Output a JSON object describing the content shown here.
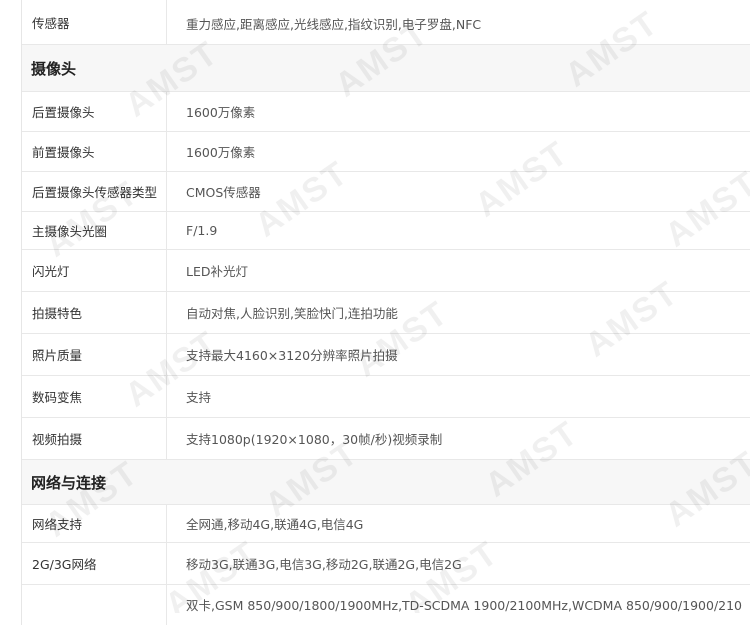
{
  "sections": [
    {
      "rows": [
        {
          "label": "传感器",
          "value": "重力感应,距离感应,光线感应,指纹识别,电子罗盘,NFC"
        }
      ]
    },
    {
      "title": "摄像头",
      "rows": [
        {
          "label": "后置摄像头",
          "value": "1600万像素"
        },
        {
          "label": "前置摄像头",
          "value": "1600万像素"
        },
        {
          "label": "后置摄像头传感器类型",
          "value": "CMOS传感器"
        },
        {
          "label": "主摄像头光圈",
          "value": "F/1.9"
        },
        {
          "label": "闪光灯",
          "value": "LED补光灯"
        },
        {
          "label": "拍摄特色",
          "value": "自动对焦,人脸识别,笑脸快门,连拍功能"
        },
        {
          "label": "照片质量",
          "value": "支持最大4160×3120分辨率照片拍摄"
        },
        {
          "label": "数码变焦",
          "value": "支持"
        },
        {
          "label": "视频拍摄",
          "value": "支持1080p(1920×1080，30帧/秒)视频录制"
        }
      ]
    },
    {
      "title": "网络与连接",
      "rows": [
        {
          "label": "网络支持",
          "value": "全网通,移动4G,联通4G,电信4G"
        },
        {
          "label": "2G/3G网络",
          "value": "移动3G,联通3G,电信3G,移动2G,联通2G,电信2G"
        },
        {
          "label": "",
          "value": "双卡,GSM 850/900/1800/1900MHz,TD-SCDMA 1900/2100MHz,WCDMA 850/900/1900/210"
        }
      ]
    }
  ],
  "watermark": "AMST"
}
